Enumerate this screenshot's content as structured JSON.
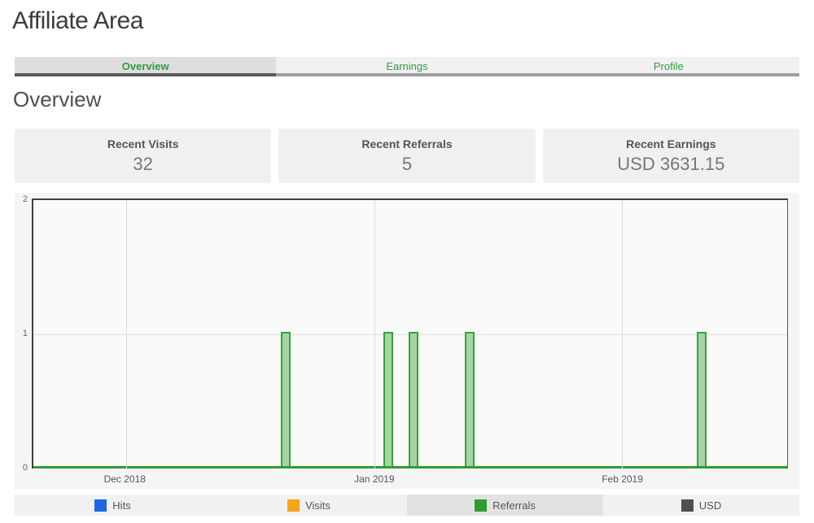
{
  "page": {
    "title": "Affiliate Area"
  },
  "tabs": {
    "items": [
      {
        "label": "Overview",
        "active": true
      },
      {
        "label": "Earnings",
        "active": false
      },
      {
        "label": "Profile",
        "active": false
      }
    ]
  },
  "overview": {
    "heading": "Overview"
  },
  "stats": {
    "items": [
      {
        "label": "Recent Visits",
        "value": "32"
      },
      {
        "label": "Recent Referrals",
        "value": "5"
      },
      {
        "label": "Recent Earnings",
        "value": "USD 3631.15"
      }
    ]
  },
  "chart_data": {
    "type": "bar",
    "title": "",
    "xlabel": "",
    "ylabel": "",
    "ylim": [
      0,
      2
    ],
    "yticks": [
      0,
      1,
      2
    ],
    "grid": true,
    "x_axis_months": [
      {
        "label": "Dec 2018",
        "pos_pct": 12.3
      },
      {
        "label": "Jan 2019",
        "pos_pct": 45.3
      },
      {
        "label": "Feb 2019",
        "pos_pct": 78.1
      }
    ],
    "series": [
      {
        "name": "Hits",
        "color": "#2066df",
        "points": []
      },
      {
        "name": "Visits",
        "color": "#f7a21b",
        "points": []
      },
      {
        "name": "Referrals",
        "color": "#2f9e2f",
        "points": [
          {
            "date": "2018-12-21",
            "value": 1,
            "pos_pct": 33.5
          },
          {
            "date": "2019-01-03",
            "value": 1,
            "pos_pct": 47.1
          },
          {
            "date": "2019-01-06",
            "value": 1,
            "pos_pct": 50.4
          },
          {
            "date": "2019-01-13",
            "value": 1,
            "pos_pct": 57.9
          },
          {
            "date": "2019-02-10",
            "value": 1,
            "pos_pct": 88.7
          }
        ]
      },
      {
        "name": "USD",
        "color": "#4f4f4f",
        "points": []
      }
    ],
    "bar_fill": "#a6d4a6",
    "bar_border": "#36a336",
    "baseline_color": "#2f9e2f",
    "legend_position": "bottom"
  },
  "legend": {
    "items": [
      {
        "label": "Hits",
        "color": "#2066df",
        "active": false
      },
      {
        "label": "Visits",
        "color": "#f7a21b",
        "active": false
      },
      {
        "label": "Referrals",
        "color": "#2f9e2f",
        "active": true
      },
      {
        "label": "USD",
        "color": "#4f4f4f",
        "active": false
      }
    ]
  },
  "colors": {
    "accent_green": "#2e9e3f",
    "tab_active_bg": "#dedede",
    "card_bg": "#f0f0f0"
  }
}
